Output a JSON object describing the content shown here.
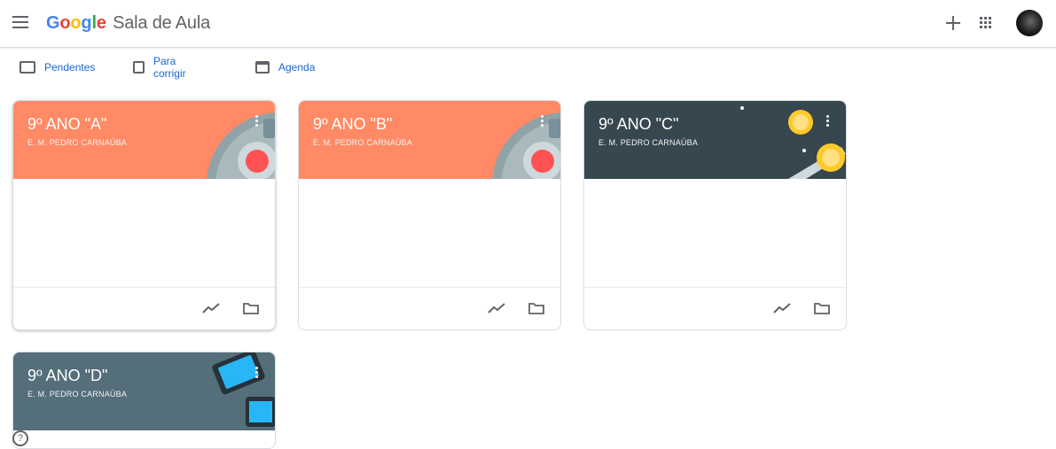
{
  "header": {
    "logo_letters": [
      {
        "ch": "G",
        "color": "#4285f4"
      },
      {
        "ch": "o",
        "color": "#ea4335"
      },
      {
        "ch": "o",
        "color": "#fbbc05"
      },
      {
        "ch": "g",
        "color": "#4285f4"
      },
      {
        "ch": "l",
        "color": "#34a853"
      },
      {
        "ch": "e",
        "color": "#ea4335"
      }
    ],
    "product_name": "Sala de Aula",
    "icons": [
      "menu-icon",
      "plus-icon",
      "apps-icon",
      "avatar"
    ]
  },
  "subnav": {
    "items": [
      {
        "label": "Pendentes",
        "icon": "todo-icon"
      },
      {
        "label": "Para corrigir",
        "icon": "review-icon"
      },
      {
        "label": "Agenda",
        "icon": "calendar-icon"
      }
    ]
  },
  "classes": [
    {
      "title": "9º ANO \"A\"",
      "subtitle": "E. M. PEDRO CARNAÚBA",
      "banner_color": "#ff8a65",
      "theme": "lab"
    },
    {
      "title": "9º ANO \"B\"",
      "subtitle": "E. M. PEDRO CARNAÚBA",
      "banner_color": "#ff8a65",
      "theme": "lab"
    },
    {
      "title": "9º ANO \"C\"",
      "subtitle": "E. M. PEDRO CARNAÚBA",
      "banner_color": "#37474f",
      "theme": "space"
    },
    {
      "title": "9º ANO \"D\"",
      "subtitle": "E. M. PEDRO CARNAÚBA",
      "banner_color": "#546e7a",
      "theme": "tablets"
    }
  ],
  "help": {
    "label": "?"
  }
}
